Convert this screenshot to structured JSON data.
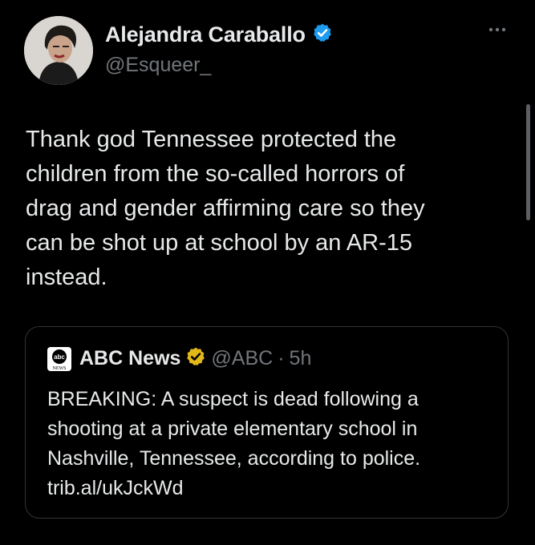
{
  "author": {
    "name": "Alejandra Caraballo",
    "handle": "@Esqueer_",
    "verified_color": "#1d9bf0"
  },
  "tweet": {
    "text": "Thank god Tennessee protected the\nchildren from the so-called horrors of\ndrag and gender affirming care so they\ncan be shot up at school by an AR-15\ninstead."
  },
  "quote": {
    "name": "ABC News",
    "handle": "@ABC",
    "separator": "·",
    "time": "5h",
    "verified_color": "#e2b719",
    "logo_text_top": "abc",
    "logo_text_bottom": "NEWS",
    "text": "BREAKING: A suspect is dead following a\nshooting at a private elementary school in\nNashville, Tennessee, according to police.\ntrib.al/ukJckWd"
  },
  "icons": {
    "more": "more-horizontal-icon",
    "verified": "verified-badge-icon"
  }
}
